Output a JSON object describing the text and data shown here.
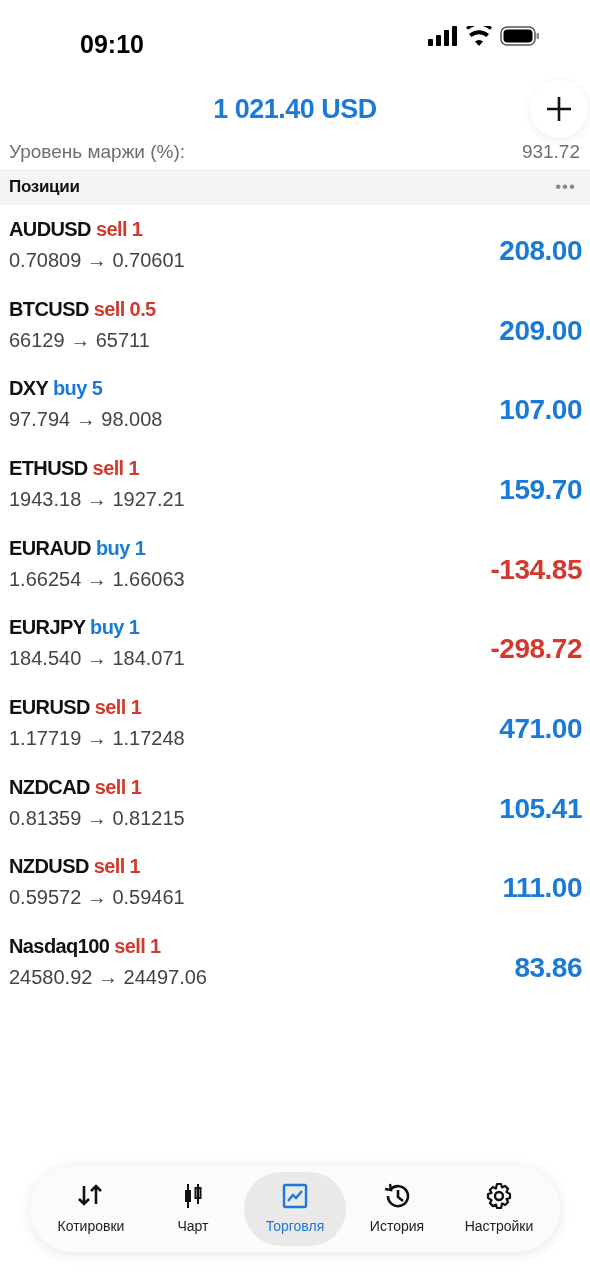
{
  "status_bar": {
    "time": "09:10"
  },
  "header": {
    "title": "1 021.40 USD"
  },
  "summary": [
    {
      "label": "Уровень маржи (%):",
      "value": "931.72"
    }
  ],
  "section": {
    "title": "Позиции",
    "menu": "•••"
  },
  "positions": [
    {
      "symbol": "AUDUSD",
      "order": "sell 1",
      "kind": "sell",
      "prices": "0.70809 → 0.70601",
      "profit": "208.00",
      "color": "#1a7ad6"
    },
    {
      "symbol": "BTCUSD",
      "order": "sell 0.5",
      "kind": "sell",
      "prices": "66129 → 65711",
      "profit": "209.00",
      "color": "#1a7ad6"
    },
    {
      "symbol": "DXY",
      "order": "buy 5",
      "kind": "buy",
      "prices": "97.794 → 98.008",
      "profit": "107.00",
      "color": "#1a7ad6"
    },
    {
      "symbol": "ETHUSD",
      "order": "sell 1",
      "kind": "sell",
      "prices": "1943.18 → 1927.21",
      "profit": "159.70",
      "color": "#1a7ad6"
    },
    {
      "symbol": "EURAUD",
      "order": "buy 1",
      "kind": "buy",
      "prices": "1.66254 → 1.66063",
      "profit": "-134.85",
      "color": "#d33a2f"
    },
    {
      "symbol": "EURJPY",
      "order": "buy 1",
      "kind": "buy",
      "prices": "184.540 → 184.071",
      "profit": "-298.72",
      "color": "#d33a2f"
    },
    {
      "symbol": "EURUSD",
      "order": "sell 1",
      "kind": "sell",
      "prices": "1.17719 → 1.17248",
      "profit": "471.00",
      "color": "#1a7ad6"
    },
    {
      "symbol": "NZDCAD",
      "order": "sell 1",
      "kind": "sell",
      "prices": "0.81359 → 0.81215",
      "profit": "105.41",
      "color": "#1a7ad6"
    },
    {
      "symbol": "NZDUSD",
      "order": "sell 1",
      "kind": "sell",
      "prices": "0.59572 → 0.59461",
      "profit": "111.00",
      "color": "#1a7ad6"
    },
    {
      "symbol": "Nasdaq100",
      "order": "sell 1",
      "kind": "sell",
      "prices": "24580.92 → 24497.06",
      "profit": "83.86",
      "color": "#1a7ad6"
    }
  ],
  "tab_bar": [
    {
      "label": "Котировки",
      "selected": false
    },
    {
      "label": "Чарт",
      "selected": false
    },
    {
      "label": "Торговля",
      "selected": true
    },
    {
      "label": "История",
      "selected": false
    },
    {
      "label": "Настройки",
      "selected": false
    }
  ]
}
